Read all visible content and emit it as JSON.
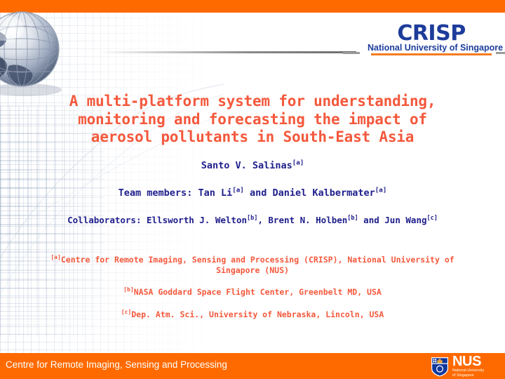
{
  "colors": {
    "orange_band": "#FF6A00",
    "title_orange": "#F4583C",
    "author_navy": "#1E1E8C",
    "logo_blue": "#1D3C9B",
    "logo_rule_orange": "#F47B20",
    "divider_gray": "#8A8A8C"
  },
  "header": {
    "logo": {
      "wordmark": "CRISP",
      "subtitle": "National University of Singapore"
    }
  },
  "title": {
    "line1": "A multi-platform system for understanding,",
    "line2": "monitoring and forecasting the impact of",
    "line3": "aerosol pollutants in South-East Asia"
  },
  "authors": {
    "lead": {
      "name": "Santo V. Salinas",
      "mark": "[a]"
    },
    "team": {
      "label": "Team members:",
      "member1": " Tan Li",
      "mark1": "[a]",
      "conjunction": " and Daniel Kalbermater",
      "mark2": "[a]"
    },
    "collaborators": {
      "label": "Collaborators:",
      "person1": " Ellsworth J. Welton",
      "mark1": "[b]",
      "sep1": ", Brent N. Holben",
      "mark2": "[b]",
      "sep2": " and Jun Wang",
      "mark3": "[c]"
    }
  },
  "affiliations": [
    {
      "mark": "[a]",
      "text": "Centre for Remote Imaging, Sensing and Processing (CRISP), National University of Singapore (NUS)"
    },
    {
      "mark": "[b]",
      "text": "NASA Goddard Space Flight Center, Greenbelt MD, USA"
    },
    {
      "mark": "[c]",
      "text": "Dep. Atm. Sci., University of Nebraska, Lincoln, USA"
    }
  ],
  "footer": {
    "text": "Centre for Remote Imaging, Sensing and Processing",
    "logo": {
      "abbr": "NUS",
      "line1": "National University",
      "line2": "of Singapore"
    }
  }
}
